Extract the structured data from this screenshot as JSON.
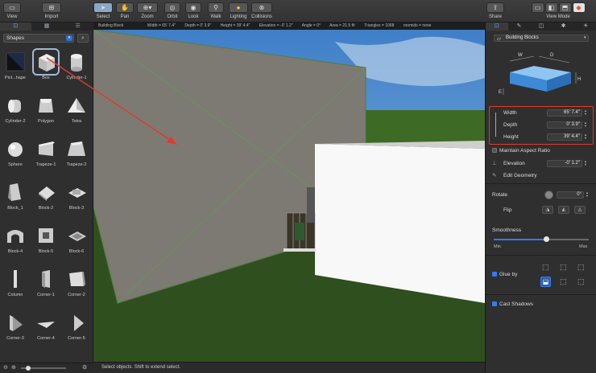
{
  "toolbar": {
    "view": "View",
    "import": "Import",
    "select": "Select",
    "pan": "Pan",
    "zoom": "Zoom",
    "orbit": "Orbit",
    "look": "Look",
    "walk": "Walk",
    "lighting": "Lighting",
    "collisions": "Collisions",
    "share": "Share",
    "view_mode": "View Mode"
  },
  "infobar": {
    "object": "Building Block",
    "width": "Width = 65' 7.4\"",
    "depth": "Depth = 0' 3.9\"",
    "height": "Height = 39' 4.4\"",
    "elevation": "Elevation = -0' 1.2\"",
    "angle": "Angle = 0°",
    "area": "Area = 21.5 ft²",
    "triangles": "Triangles = 1068",
    "rooms": "roomids = none"
  },
  "library": {
    "category": "Shapes",
    "items": [
      {
        "label": "Pict...hape"
      },
      {
        "label": "Box"
      },
      {
        "label": "Cylinder-1"
      },
      {
        "label": "Cylinder-2"
      },
      {
        "label": "Polygon"
      },
      {
        "label": "Tetra"
      },
      {
        "label": "Sphere"
      },
      {
        "label": "Trapeze-1"
      },
      {
        "label": "Trapeze-2"
      },
      {
        "label": "Block_1"
      },
      {
        "label": "Block-2"
      },
      {
        "label": "Block-3"
      },
      {
        "label": "Block-4"
      },
      {
        "label": "Block-5"
      },
      {
        "label": "Block-6"
      },
      {
        "label": "Column"
      },
      {
        "label": "Corner-1"
      },
      {
        "label": "Corner-2"
      },
      {
        "label": "Corner-3"
      },
      {
        "label": "Corner-4"
      },
      {
        "label": "Corner-5"
      }
    ]
  },
  "status": {
    "text": "Select objects. Shift to extend select."
  },
  "inspector": {
    "object_type": "Building Blocks",
    "diagram": {
      "w": "W",
      "d": "D",
      "h": "H",
      "e": "E"
    },
    "width_label": "Width",
    "width_value": "65' 7.4\"",
    "depth_label": "Depth",
    "depth_value": "0' 3.9\"",
    "height_label": "Height",
    "height_value": "39' 4.4\"",
    "maintain_aspect": "Maintain Aspect Ratio",
    "elevation_label": "Elevation",
    "elevation_value": "-0' 1.2\"",
    "edit_geometry": "Edit Geometry",
    "rotate_label": "Rotate",
    "rotate_value": "0°",
    "flip_label": "Flip",
    "smoothness_label": "Smoothness",
    "smoothness_level": 0.55,
    "min_label": "Min",
    "max_label": "Max",
    "glue_label": "Glue by",
    "cast_shadows": "Cast Shadows"
  },
  "colors": {
    "accent": "#2f7cf6",
    "highlight": "#e03a2a",
    "grass": "#2f4f1e",
    "sky": "#4a8bcf",
    "wall": "#7c7a72"
  }
}
